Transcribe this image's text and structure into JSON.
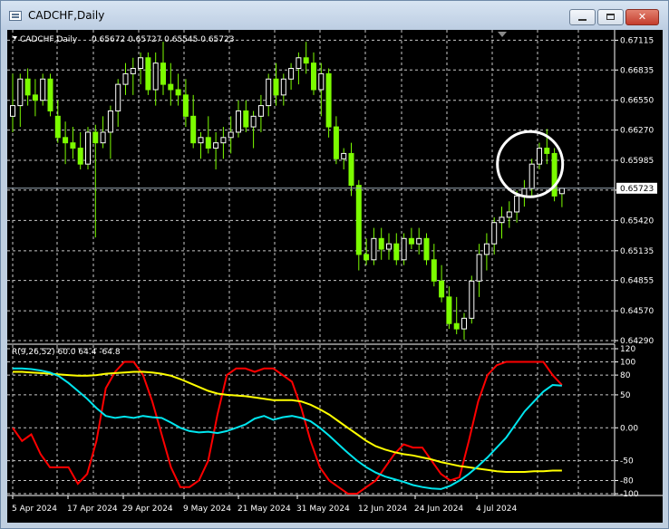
{
  "window": {
    "title": "CADCHF,Daily",
    "min_label": "",
    "max_label": "",
    "close_label": "✕"
  },
  "chart_data": [
    {
      "type": "candlestick",
      "title": "CADCHF,Daily",
      "ohlc_label": "0.65672 0.65727 0.65545 0.65723",
      "last_price_label": "0.65723",
      "ylim": [
        0.6429,
        0.6711
      ],
      "y_ticks": [
        "0.67115",
        "0.66835",
        "0.66550",
        "0.66270",
        "0.65985",
        "0.65705",
        "0.65420",
        "0.65135",
        "0.64855",
        "0.64570",
        "0.64290"
      ],
      "grid": true,
      "colors": {
        "bull": "#ffffff",
        "bear": "#7cfc00",
        "background": "#000000"
      },
      "annotation": "circle around the early-July high",
      "candles": [
        {
          "o": 0.664,
          "h": 0.668,
          "l": 0.6625,
          "c": 0.665
        },
        {
          "o": 0.665,
          "h": 0.668,
          "l": 0.663,
          "c": 0.6675
        },
        {
          "o": 0.6675,
          "h": 0.6685,
          "l": 0.665,
          "c": 0.666
        },
        {
          "o": 0.666,
          "h": 0.6675,
          "l": 0.664,
          "c": 0.6655
        },
        {
          "o": 0.6655,
          "h": 0.668,
          "l": 0.665,
          "c": 0.6675
        },
        {
          "o": 0.6675,
          "h": 0.668,
          "l": 0.664,
          "c": 0.6645
        },
        {
          "o": 0.664,
          "h": 0.6655,
          "l": 0.6615,
          "c": 0.662
        },
        {
          "o": 0.662,
          "h": 0.6635,
          "l": 0.6595,
          "c": 0.6615
        },
        {
          "o": 0.6615,
          "h": 0.663,
          "l": 0.66,
          "c": 0.661
        },
        {
          "o": 0.661,
          "h": 0.6625,
          "l": 0.659,
          "c": 0.6595
        },
        {
          "o": 0.6595,
          "h": 0.663,
          "l": 0.659,
          "c": 0.6625
        },
        {
          "o": 0.6625,
          "h": 0.6632,
          "l": 0.6526,
          "c": 0.6615
        },
        {
          "o": 0.6615,
          "h": 0.664,
          "l": 0.661,
          "c": 0.6625
        },
        {
          "o": 0.6625,
          "h": 0.665,
          "l": 0.66,
          "c": 0.6645
        },
        {
          "o": 0.6645,
          "h": 0.6675,
          "l": 0.663,
          "c": 0.667
        },
        {
          "o": 0.667,
          "h": 0.669,
          "l": 0.666,
          "c": 0.668
        },
        {
          "o": 0.668,
          "h": 0.6695,
          "l": 0.666,
          "c": 0.6685
        },
        {
          "o": 0.6685,
          "h": 0.67,
          "l": 0.667,
          "c": 0.6695
        },
        {
          "o": 0.6695,
          "h": 0.67,
          "l": 0.666,
          "c": 0.6665
        },
        {
          "o": 0.6665,
          "h": 0.67,
          "l": 0.665,
          "c": 0.669
        },
        {
          "o": 0.669,
          "h": 0.671,
          "l": 0.666,
          "c": 0.667
        },
        {
          "o": 0.667,
          "h": 0.669,
          "l": 0.665,
          "c": 0.6665
        },
        {
          "o": 0.6665,
          "h": 0.668,
          "l": 0.665,
          "c": 0.666
        },
        {
          "o": 0.666,
          "h": 0.6675,
          "l": 0.663,
          "c": 0.664
        },
        {
          "o": 0.664,
          "h": 0.666,
          "l": 0.661,
          "c": 0.6615
        },
        {
          "o": 0.6615,
          "h": 0.6625,
          "l": 0.66,
          "c": 0.662
        },
        {
          "o": 0.662,
          "h": 0.664,
          "l": 0.6605,
          "c": 0.661
        },
        {
          "o": 0.661,
          "h": 0.6625,
          "l": 0.659,
          "c": 0.6615
        },
        {
          "o": 0.6615,
          "h": 0.663,
          "l": 0.66,
          "c": 0.662
        },
        {
          "o": 0.662,
          "h": 0.664,
          "l": 0.6605,
          "c": 0.6625
        },
        {
          "o": 0.6625,
          "h": 0.6655,
          "l": 0.662,
          "c": 0.6645
        },
        {
          "o": 0.6645,
          "h": 0.6655,
          "l": 0.6625,
          "c": 0.663
        },
        {
          "o": 0.663,
          "h": 0.6645,
          "l": 0.661,
          "c": 0.664
        },
        {
          "o": 0.664,
          "h": 0.666,
          "l": 0.6625,
          "c": 0.665
        },
        {
          "o": 0.665,
          "h": 0.668,
          "l": 0.664,
          "c": 0.6675
        },
        {
          "o": 0.6675,
          "h": 0.669,
          "l": 0.665,
          "c": 0.666
        },
        {
          "o": 0.666,
          "h": 0.668,
          "l": 0.665,
          "c": 0.6675
        },
        {
          "o": 0.6675,
          "h": 0.669,
          "l": 0.6665,
          "c": 0.6685
        },
        {
          "o": 0.6685,
          "h": 0.67,
          "l": 0.667,
          "c": 0.6695
        },
        {
          "o": 0.6695,
          "h": 0.671,
          "l": 0.668,
          "c": 0.669
        },
        {
          "o": 0.669,
          "h": 0.67,
          "l": 0.666,
          "c": 0.6665
        },
        {
          "o": 0.6665,
          "h": 0.669,
          "l": 0.664,
          "c": 0.668
        },
        {
          "o": 0.668,
          "h": 0.6685,
          "l": 0.662,
          "c": 0.663
        },
        {
          "o": 0.663,
          "h": 0.664,
          "l": 0.6595,
          "c": 0.66
        },
        {
          "o": 0.66,
          "h": 0.661,
          "l": 0.659,
          "c": 0.6605
        },
        {
          "o": 0.6605,
          "h": 0.6615,
          "l": 0.6565,
          "c": 0.6575
        },
        {
          "o": 0.6575,
          "h": 0.658,
          "l": 0.6495,
          "c": 0.651
        },
        {
          "o": 0.651,
          "h": 0.6525,
          "l": 0.65,
          "c": 0.6505
        },
        {
          "o": 0.6505,
          "h": 0.6535,
          "l": 0.65,
          "c": 0.6525
        },
        {
          "o": 0.6525,
          "h": 0.6535,
          "l": 0.6505,
          "c": 0.6515
        },
        {
          "o": 0.6515,
          "h": 0.653,
          "l": 0.6505,
          "c": 0.652
        },
        {
          "o": 0.652,
          "h": 0.653,
          "l": 0.65,
          "c": 0.6505
        },
        {
          "o": 0.6505,
          "h": 0.653,
          "l": 0.65,
          "c": 0.6525
        },
        {
          "o": 0.6525,
          "h": 0.6535,
          "l": 0.6515,
          "c": 0.652
        },
        {
          "o": 0.652,
          "h": 0.6535,
          "l": 0.651,
          "c": 0.6525
        },
        {
          "o": 0.6525,
          "h": 0.653,
          "l": 0.65,
          "c": 0.6505
        },
        {
          "o": 0.6505,
          "h": 0.652,
          "l": 0.648,
          "c": 0.6485
        },
        {
          "o": 0.6485,
          "h": 0.65,
          "l": 0.6465,
          "c": 0.647
        },
        {
          "o": 0.647,
          "h": 0.648,
          "l": 0.644,
          "c": 0.6445
        },
        {
          "o": 0.6445,
          "h": 0.647,
          "l": 0.6435,
          "c": 0.644
        },
        {
          "o": 0.644,
          "h": 0.6455,
          "l": 0.643,
          "c": 0.645
        },
        {
          "o": 0.645,
          "h": 0.649,
          "l": 0.6445,
          "c": 0.6485
        },
        {
          "o": 0.6485,
          "h": 0.652,
          "l": 0.647,
          "c": 0.651
        },
        {
          "o": 0.651,
          "h": 0.653,
          "l": 0.6495,
          "c": 0.652
        },
        {
          "o": 0.652,
          "h": 0.6545,
          "l": 0.651,
          "c": 0.654
        },
        {
          "o": 0.654,
          "h": 0.6555,
          "l": 0.6525,
          "c": 0.6545
        },
        {
          "o": 0.6545,
          "h": 0.656,
          "l": 0.6535,
          "c": 0.655
        },
        {
          "o": 0.655,
          "h": 0.657,
          "l": 0.654,
          "c": 0.6565
        },
        {
          "o": 0.6565,
          "h": 0.658,
          "l": 0.6555,
          "c": 0.6572
        },
        {
          "o": 0.6572,
          "h": 0.66,
          "l": 0.6565,
          "c": 0.6595
        },
        {
          "o": 0.6595,
          "h": 0.6615,
          "l": 0.659,
          "c": 0.661
        },
        {
          "o": 0.661,
          "h": 0.6628,
          "l": 0.6595,
          "c": 0.6605
        },
        {
          "o": 0.6605,
          "h": 0.661,
          "l": 0.656,
          "c": 0.6565
        },
        {
          "o": 0.65672,
          "h": 0.65727,
          "l": 0.65545,
          "c": 0.65723
        }
      ]
    },
    {
      "type": "line",
      "title": "R(9,26,52) 60.0 64.4 -64.8",
      "ylim": [
        -100,
        120
      ],
      "y_ticks": [
        "120",
        "100",
        "80",
        "50",
        "0.00",
        "-50",
        "-80",
        "-100"
      ],
      "grid": true,
      "x": [
        "5 Apr 2024",
        "17 Apr 2024",
        "29 Apr 2024",
        "9 May 2024",
        "21 May 2024",
        "31 May 2024",
        "12 Jun 2024",
        "24 Jun 2024",
        "4 Jul 2024"
      ],
      "series": [
        {
          "color": "#ff0000",
          "values": [
            0,
            -20,
            -10,
            -40,
            -60,
            -60,
            -60,
            -85,
            -70,
            -20,
            60,
            85,
            100,
            100,
            80,
            40,
            -10,
            -60,
            -90,
            -90,
            -80,
            -50,
            20,
            80,
            90,
            90,
            85,
            90,
            90,
            80,
            70,
            30,
            -20,
            -60,
            -80,
            -90,
            -100,
            -100,
            -90,
            -80,
            -60,
            -40,
            -25,
            -30,
            -30,
            -50,
            -70,
            -80,
            -75,
            -20,
            40,
            80,
            95,
            100,
            100,
            100,
            100,
            100,
            80,
            65
          ]
        },
        {
          "color": "#ffff00",
          "values": [
            85,
            85,
            84,
            83,
            82,
            81,
            80,
            79,
            79,
            80,
            82,
            83,
            84,
            85,
            85,
            84,
            82,
            79,
            74,
            68,
            62,
            56,
            52,
            50,
            49,
            48,
            46,
            44,
            42,
            42,
            42,
            40,
            35,
            28,
            20,
            10,
            0,
            -10,
            -20,
            -28,
            -33,
            -37,
            -40,
            -42,
            -45,
            -48,
            -52,
            -55,
            -58,
            -60,
            -62,
            -64,
            -66,
            -67,
            -67,
            -67,
            -66,
            -66,
            -65,
            -65
          ]
        },
        {
          "color": "#00e5ee",
          "values": [
            90,
            90,
            89,
            87,
            84,
            78,
            68,
            56,
            44,
            30,
            18,
            15,
            17,
            15,
            18,
            16,
            15,
            8,
            0,
            -5,
            -7,
            -6,
            -8,
            -5,
            0,
            5,
            14,
            18,
            12,
            16,
            18,
            15,
            10,
            0,
            -12,
            -25,
            -38,
            -50,
            -60,
            -68,
            -74,
            -78,
            -82,
            -87,
            -90,
            -92,
            -93,
            -88,
            -80,
            -70,
            -58,
            -45,
            -30,
            -15,
            5,
            25,
            40,
            55,
            65,
            64
          ]
        }
      ]
    }
  ]
}
